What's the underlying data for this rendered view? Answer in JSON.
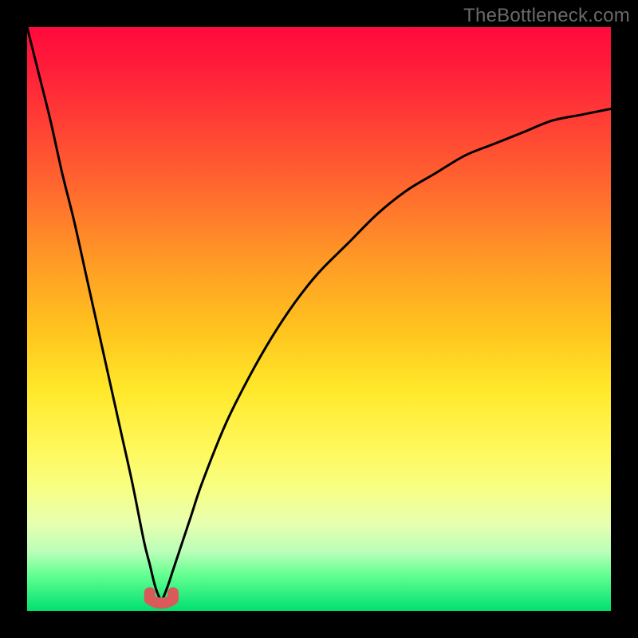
{
  "watermark": "TheBottleneck.com",
  "colors": {
    "frame": "#000000",
    "curve": "#000000",
    "marker": "#d85a5a"
  },
  "chart_data": {
    "type": "line",
    "title": "",
    "xlabel": "",
    "ylabel": "",
    "xlim": [
      0,
      100
    ],
    "ylim": [
      0,
      100
    ],
    "grid": false,
    "legend": false,
    "notes": "Absolute-deviation style curve. x is a normalized parameter (0–100, left→right). y is the plotted value (0 at bottom, 100 at top). Minimum near x≈23 where y≈2.",
    "series": [
      {
        "name": "curve",
        "x": [
          0,
          2,
          4,
          6,
          8,
          10,
          12,
          14,
          16,
          18,
          20,
          21,
          22,
          23,
          24,
          25,
          26,
          28,
          30,
          34,
          38,
          42,
          46,
          50,
          55,
          60,
          65,
          70,
          75,
          80,
          85,
          90,
          95,
          100
        ],
        "y": [
          100,
          92,
          84,
          75,
          67,
          58,
          49,
          40,
          31,
          22,
          12,
          8,
          4,
          2,
          4,
          7,
          10,
          16,
          22,
          32,
          40,
          47,
          53,
          58,
          63,
          68,
          72,
          75,
          78,
          80,
          82,
          84,
          85,
          86
        ]
      }
    ],
    "markers": [
      {
        "name": "min-segment",
        "x_range": [
          21,
          25
        ],
        "y": 2
      }
    ]
  }
}
